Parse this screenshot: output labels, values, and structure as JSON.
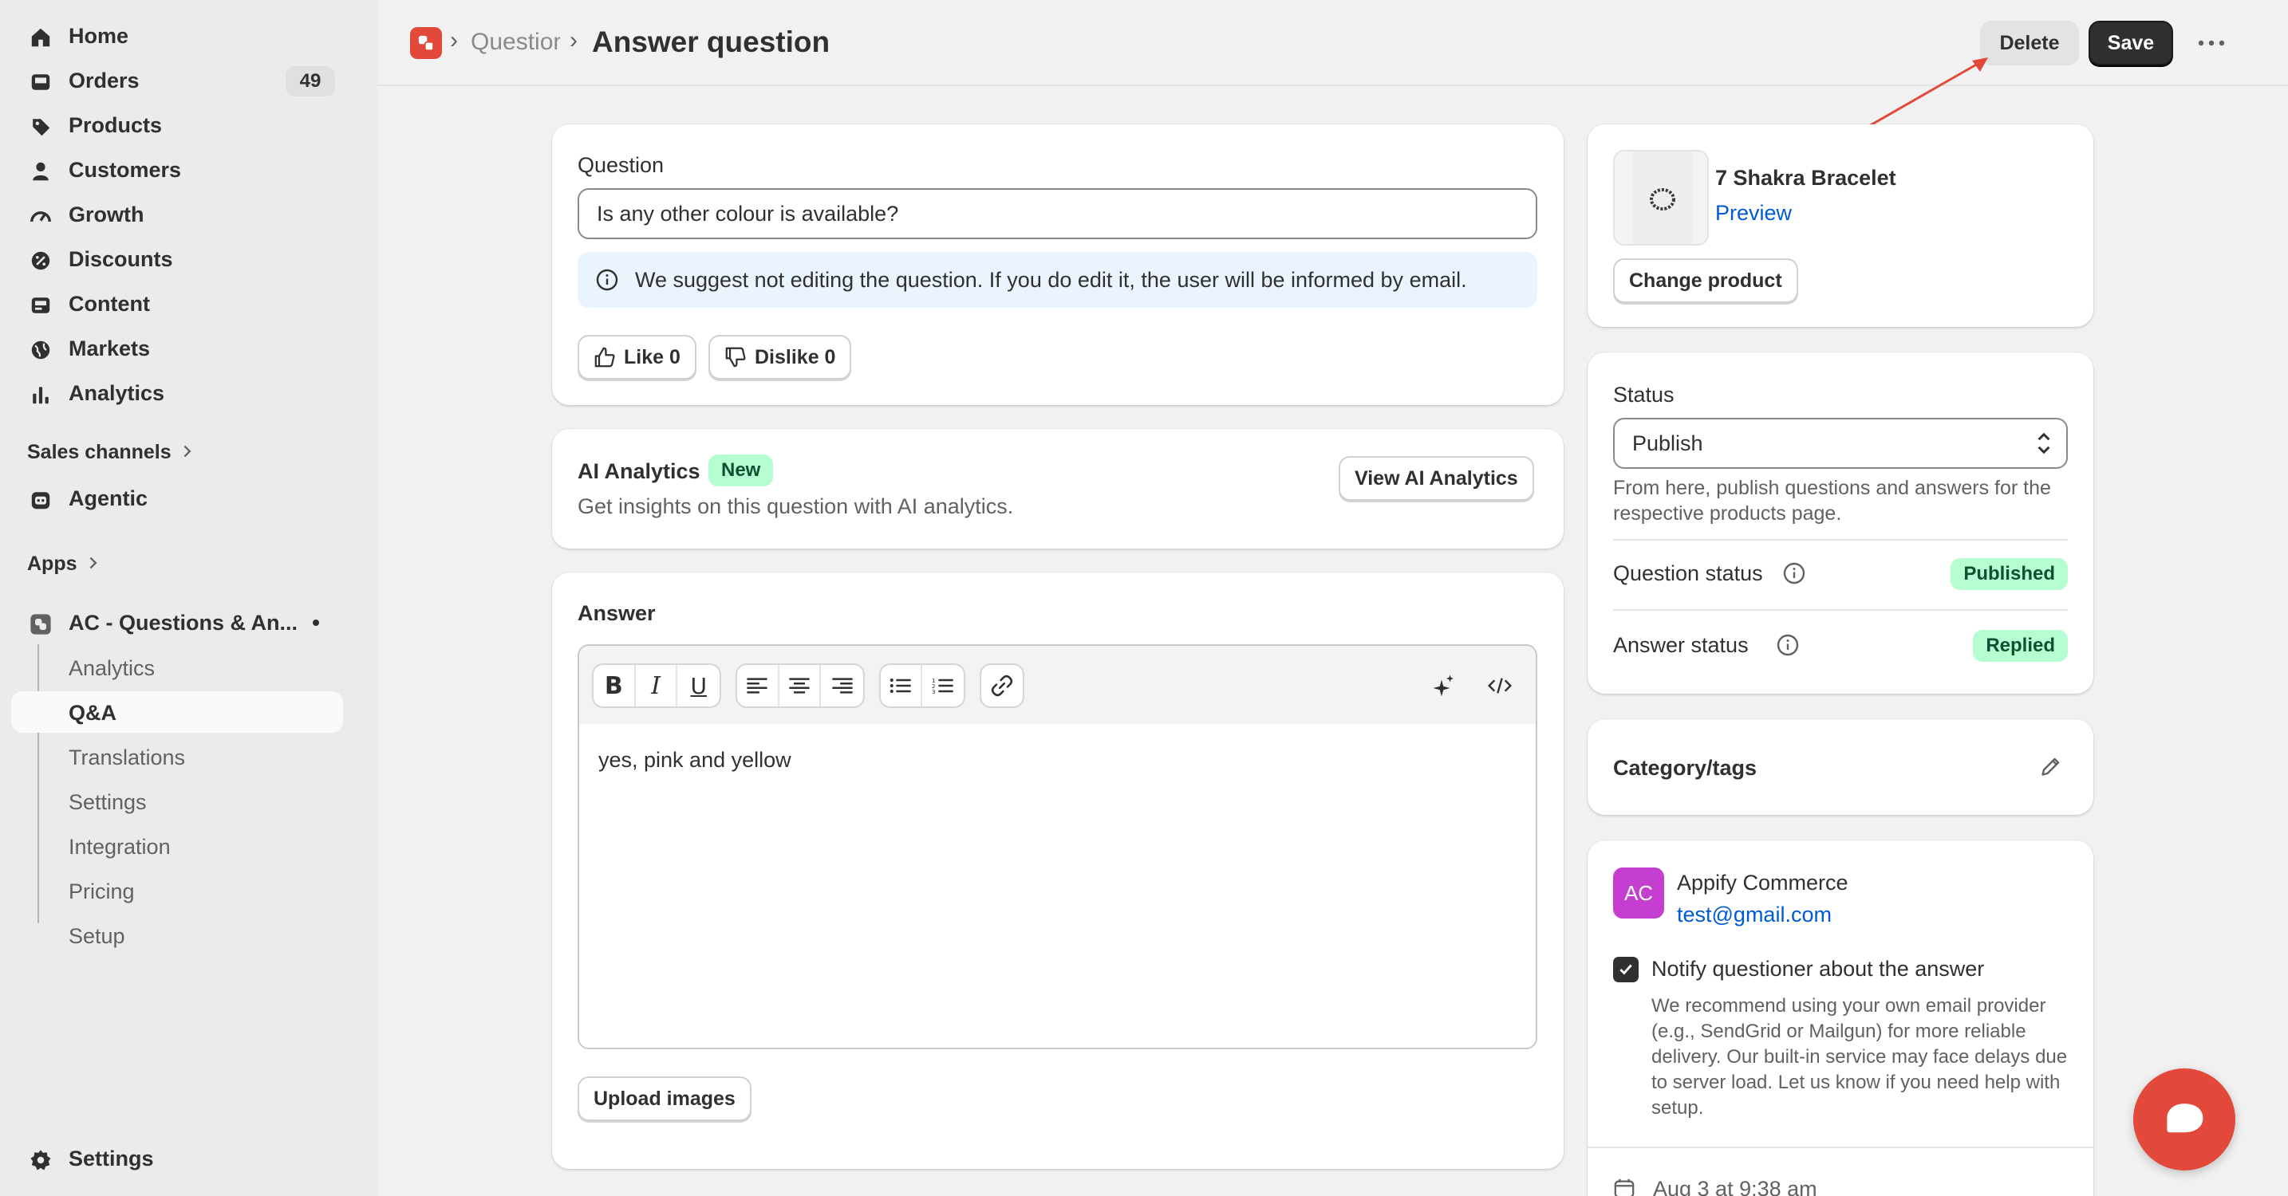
{
  "sidebar": {
    "nav": [
      {
        "label": "Home",
        "icon": "home-icon"
      },
      {
        "label": "Orders",
        "icon": "inbox-icon",
        "badge": "49"
      },
      {
        "label": "Products",
        "icon": "tag-icon"
      },
      {
        "label": "Customers",
        "icon": "person-icon"
      },
      {
        "label": "Growth",
        "icon": "gauge-icon"
      },
      {
        "label": "Discounts",
        "icon": "discount-icon"
      },
      {
        "label": "Content",
        "icon": "content-icon"
      },
      {
        "label": "Markets",
        "icon": "globe-icon"
      },
      {
        "label": "Analytics",
        "icon": "bar-chart-icon"
      }
    ],
    "sales_channels_label": "Sales channels",
    "agentic_label": "Agentic",
    "apps_label": "Apps",
    "app_name": "AC - Questions & An...",
    "app_sub": [
      "Analytics",
      "Q&A",
      "Translations",
      "Settings",
      "Integration",
      "Pricing",
      "Setup"
    ],
    "settings_label": "Settings"
  },
  "header": {
    "breadcrumb_parent": "Questions",
    "title": "Answer question",
    "delete_label": "Delete",
    "save_label": "Save"
  },
  "question_card": {
    "label": "Question",
    "value": "Is any other colour is available?",
    "info": "We suggest not editing the question. If you do edit it, the user will be informed by email.",
    "like_label": "Like 0",
    "dislike_label": "Dislike 0"
  },
  "ai_card": {
    "title": "AI Analytics",
    "badge": "New",
    "description": "Get insights on this question with AI analytics.",
    "button": "View AI Analytics"
  },
  "answer_card": {
    "label": "Answer",
    "content": "yes, pink and yellow",
    "upload_label": "Upload images"
  },
  "product_card": {
    "name": "7 Shakra Bracelet",
    "preview_label": "Preview",
    "change_label": "Change product"
  },
  "status_card": {
    "label": "Status",
    "selected": "Publish",
    "help": "From here, publish questions and answers for the respective products page.",
    "question_status_label": "Question status",
    "question_status_value": "Published",
    "answer_status_label": "Answer status",
    "answer_status_value": "Replied"
  },
  "category_card": {
    "title": "Category/tags"
  },
  "customer_card": {
    "initials": "AC",
    "name": "Appify Commerce",
    "email": "test@gmail.com",
    "notify_label": "Notify questioner about the answer",
    "notify_checked": true,
    "notify_help": "We recommend using your own email provider (e.g., SendGrid or Mailgun) for more reliable delivery. Our built-in service may face delays due to server load. Let us know if you need help with setup.",
    "date": "Aug 3 at 9:38 am"
  },
  "colors": {
    "accent_red": "#e2493b",
    "avatar_purple": "#c43fd0",
    "link_blue": "#005bd3",
    "success_bg": "#b4fed2"
  }
}
